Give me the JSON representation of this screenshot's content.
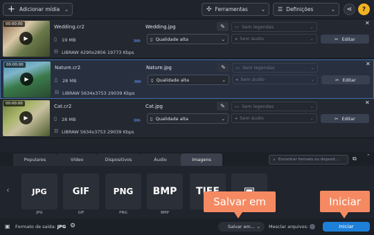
{
  "toolbar": {
    "add_media": "Adicionar mídia",
    "tools": "Ferramentas",
    "settings": "Definições",
    "help": "?"
  },
  "files": [
    {
      "duration": "00:00:00",
      "name": "Wedding.cr2",
      "size": "19 MB",
      "meta": "LIBRAW 4290x2856 19773 Kbps",
      "output": "Wedding.jpg",
      "quality": "Qualidade alta",
      "subtitles": "Sem legendas",
      "audio": "Sem áudio",
      "edit": "Editar",
      "selected": false
    },
    {
      "duration": "00:00:00",
      "name": "Nature.cr2",
      "size": "28 MB",
      "meta": "LIBRAW 5634x3753 29039 Kbps",
      "output": "Nature.jpg",
      "quality": "Qualidade alta",
      "subtitles": "Sem legendas",
      "audio": "Sem áudio",
      "edit": "Editar",
      "selected": true
    },
    {
      "duration": "00:00:00",
      "name": "Cat.cr2",
      "size": "28 MB",
      "meta": "LIBRAW 5634x3753 29039 Kbps",
      "output": "Cat.jpg",
      "quality": "Qualidade alta",
      "subtitles": "Sem legendas",
      "audio": "Sem áudio",
      "edit": "Editar",
      "selected": false
    }
  ],
  "tabs": [
    "Populares",
    "Vídeo",
    "Dispositivos",
    "Áudio",
    "Imagens"
  ],
  "active_tab": "Imagens",
  "search_placeholder": "Encontrar formato ou disposit...",
  "formats": [
    {
      "icon": "JPG",
      "label": "JPG"
    },
    {
      "icon": "GIF",
      "label": "GIF"
    },
    {
      "icon": "PNG",
      "label": "PNG"
    },
    {
      "icon": "BMP",
      "label": "BMP"
    },
    {
      "icon": "TIFF",
      "label": ""
    },
    {
      "icon": "",
      "label": ""
    }
  ],
  "footer": {
    "output_format_label": "Formato de saída:",
    "output_format_value": "JPG",
    "save_to": "Salvar em...",
    "merge_files": "Mesclar arquivos:",
    "start": "Iniciar"
  },
  "callouts": {
    "save": "Salvar em",
    "start": "Iniciar"
  },
  "colors": {
    "accent_blue": "#1e7fd9",
    "callout": "#f58a62",
    "help_yellow": "#f2b322"
  }
}
